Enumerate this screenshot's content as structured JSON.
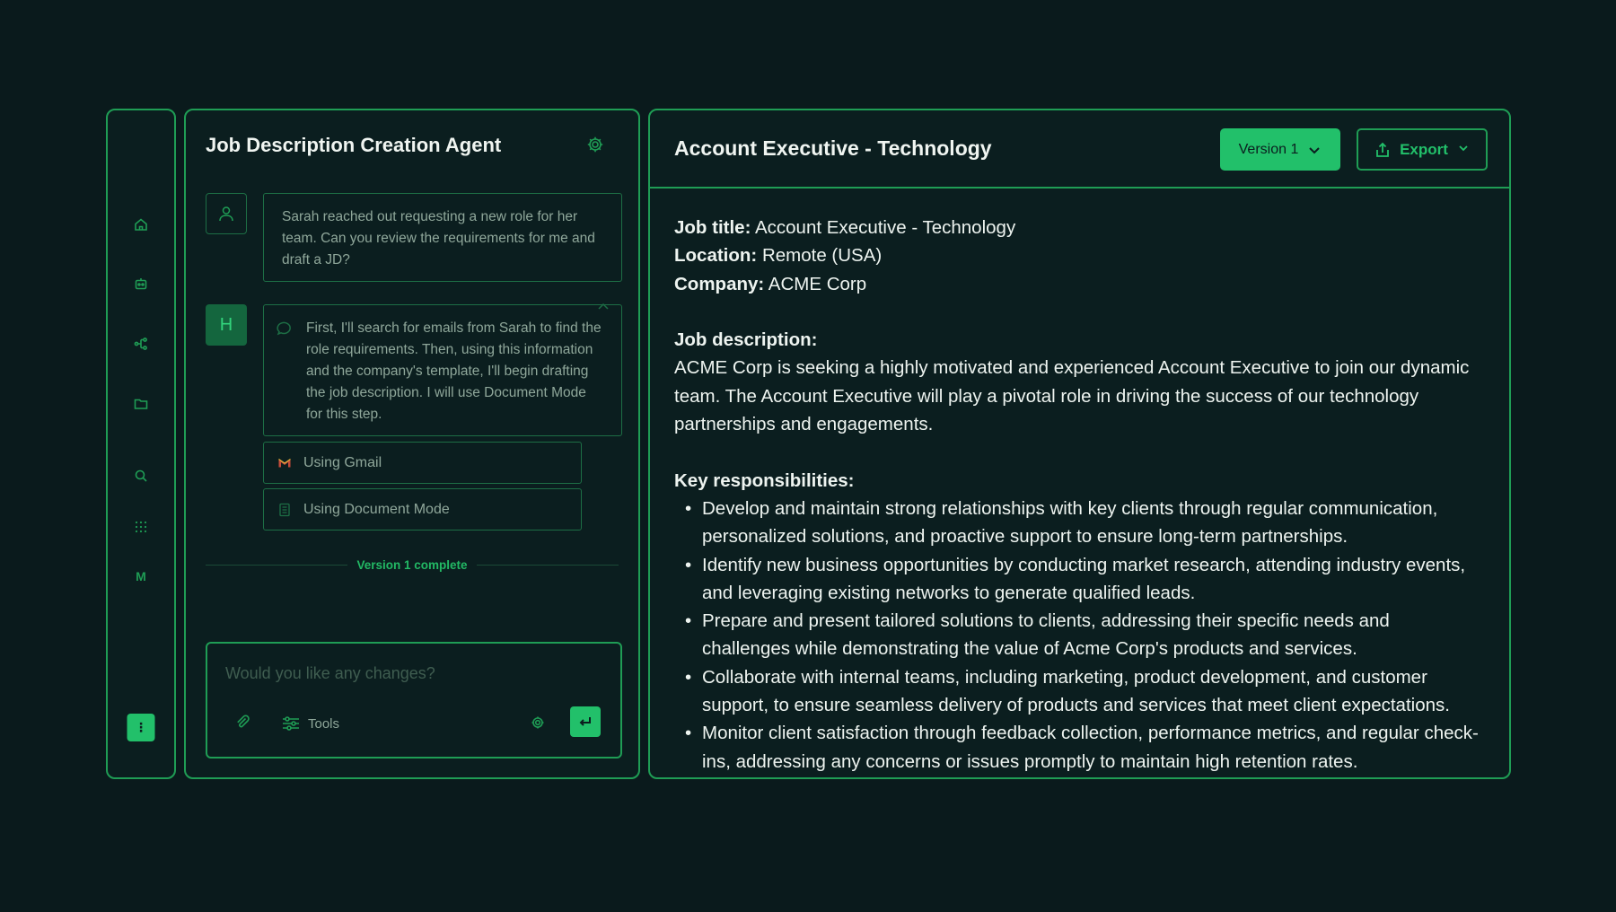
{
  "rail": {
    "icons": [
      "home-icon",
      "robot-icon",
      "workflow-icon",
      "folder-icon",
      "search-icon",
      "apps-grid-icon"
    ],
    "letter_item": "M",
    "menu_glyph": "⋮"
  },
  "chat": {
    "title": "Job Description Creation Agent",
    "user_message": "Sarah reached out requesting a new role for her team. Can you review the requirements for me and draft a JD?",
    "agent_avatar": "H",
    "agent_message": "First, I'll search for emails from Sarah to find the role requirements. Then, using this information and the company's template, I'll begin drafting the job description. I will use Document Mode for this step.",
    "tool_steps": [
      {
        "label": "Using Gmail",
        "icon": "gmail-icon"
      },
      {
        "label": "Using Document Mode",
        "icon": "document-icon"
      }
    ],
    "status_divider": "Version 1 complete",
    "composer": {
      "placeholder": "Would you like any changes?",
      "tools_label": "Tools"
    }
  },
  "document": {
    "title": "Account Executive - Technology",
    "version_label": "Version 1",
    "export_label": "Export",
    "fields": [
      {
        "label": "Job title:",
        "value": " Account Executive - Technology"
      },
      {
        "label": "Location:",
        "value": " Remote (USA)"
      },
      {
        "label": "Company:",
        "value": " ACME Corp"
      }
    ],
    "description_heading": "Job description:",
    "description": "ACME Corp is seeking a highly motivated and experienced Account Executive to join our dynamic team. The Account Executive will play a pivotal role in driving the success of our technology partnerships and engagements.",
    "responsibilities_heading": "Key responsibilities:",
    "responsibilities": [
      "Develop and maintain strong relationships with key clients through regular communication, personalized solutions, and proactive support to ensure long-term partnerships.",
      "Identify new business opportunities by conducting market research, attending industry events, and leveraging existing networks to generate qualified leads.",
      "Prepare and present tailored solutions to clients, addressing their specific needs and challenges while demonstrating the value of Acme Corp's products and services.",
      "Collaborate with internal teams, including marketing, product development, and customer support, to ensure seamless delivery of products and services that meet client expectations.",
      "Monitor client satisfaction through feedback collection, performance metrics, and regular check-ins, addressing any concerns or issues promptly to maintain high retention rates."
    ]
  },
  "colors": {
    "background": "#0a1a1c",
    "accent": "#22c06a",
    "border": "#1f9d55"
  }
}
